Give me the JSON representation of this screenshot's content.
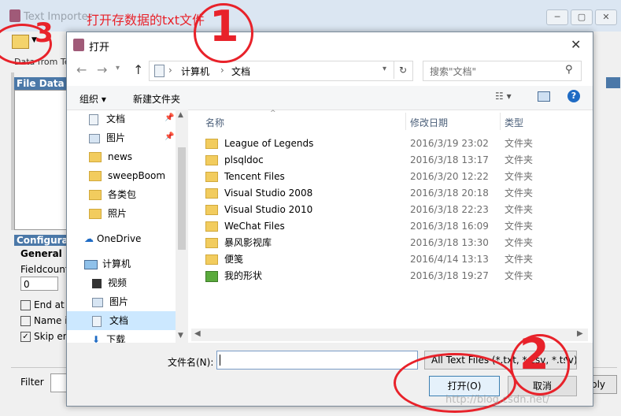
{
  "background_window": {
    "title": "Text Importer",
    "annotation_text": "打开存数据的txt文件",
    "data_from": "Data from Te",
    "file_data": "File Data",
    "config_header": "Configurati",
    "general": "General",
    "fieldcount_label": "Fieldcount",
    "fieldcount_value": "0",
    "checkboxes": [
      {
        "label": "End at l",
        "checked": false
      },
      {
        "label": "Name in",
        "checked": false
      },
      {
        "label": "Skip em",
        "checked": true
      }
    ],
    "filter_label": "Filter",
    "apply_label": "ply"
  },
  "dialog": {
    "title": "打开",
    "close_symbol": "✕",
    "address": {
      "segments": [
        "计算机",
        "文档"
      ]
    },
    "search_placeholder": "搜索\"文档\"",
    "organize_label": "组织 ▾",
    "new_folder_label": "新建文件夹",
    "nav_items": [
      {
        "label": "文档",
        "icon": "document-icon",
        "pinned": true,
        "selected": false
      },
      {
        "label": "图片",
        "icon": "pictures-icon",
        "pinned": true,
        "selected": false
      },
      {
        "label": "news",
        "icon": "folder-icon",
        "pinned": false,
        "selected": false
      },
      {
        "label": "sweepBoom",
        "icon": "folder-icon",
        "pinned": false,
        "selected": false
      },
      {
        "label": "各类包",
        "icon": "folder-icon",
        "pinned": false,
        "selected": false
      },
      {
        "label": "照片",
        "icon": "folder-icon",
        "pinned": false,
        "selected": false
      },
      {
        "label": "OneDrive",
        "icon": "cloud-icon",
        "pinned": false,
        "selected": false
      },
      {
        "label": "计算机",
        "icon": "computer-icon",
        "pinned": false,
        "selected": false
      },
      {
        "label": "视频",
        "icon": "video-icon",
        "pinned": false,
        "selected": false
      },
      {
        "label": "图片",
        "icon": "pictures-icon",
        "pinned": false,
        "selected": false
      },
      {
        "label": "文档",
        "icon": "document-icon",
        "pinned": false,
        "selected": true
      },
      {
        "label": "下载",
        "icon": "download-icon",
        "pinned": false,
        "selected": false
      }
    ],
    "columns": {
      "name": "名称",
      "date": "修改日期",
      "type": "类型"
    },
    "files": [
      {
        "name": "League of Legends",
        "date": "2016/3/19 23:02",
        "type": "文件夹",
        "icon": "folder-icon"
      },
      {
        "name": "plsqldoc",
        "date": "2016/3/18 13:17",
        "type": "文件夹",
        "icon": "folder-icon"
      },
      {
        "name": "Tencent Files",
        "date": "2016/3/20 12:22",
        "type": "文件夹",
        "icon": "folder-icon"
      },
      {
        "name": "Visual Studio 2008",
        "date": "2016/3/18 20:18",
        "type": "文件夹",
        "icon": "folder-icon"
      },
      {
        "name": "Visual Studio 2010",
        "date": "2016/3/18 22:23",
        "type": "文件夹",
        "icon": "folder-icon"
      },
      {
        "name": "WeChat Files",
        "date": "2016/3/18 16:09",
        "type": "文件夹",
        "icon": "folder-icon"
      },
      {
        "name": "暴风影视库",
        "date": "2016/3/18 13:30",
        "type": "文件夹",
        "icon": "folder-icon"
      },
      {
        "name": "便笺",
        "date": "2016/4/14 13:13",
        "type": "文件夹",
        "icon": "folder-icon"
      },
      {
        "name": "我的形状",
        "date": "2016/3/18 19:27",
        "type": "文件夹",
        "icon": "shapes-folder-icon"
      }
    ],
    "filename_label": "文件名(N):",
    "filename_value": "",
    "filetype_value": "All Text Files (*.txt, *.csv, *.tsv)",
    "open_label": "打开(O)",
    "cancel_label": "取消"
  },
  "annotations": {
    "one": "1",
    "two": "2",
    "three": "3"
  },
  "watermark": "http://blog.csdn.net/",
  "colors": {
    "annotation_red": "#e8222a",
    "selected_bg": "#cce8ff",
    "header_blue": "#4b78a8"
  }
}
